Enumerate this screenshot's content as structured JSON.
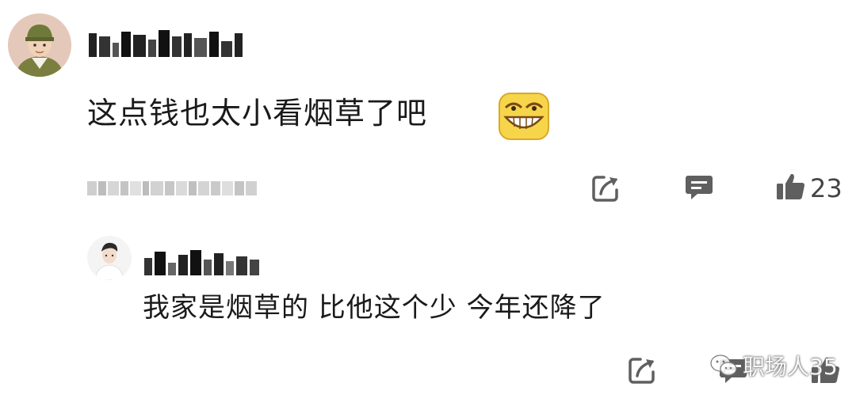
{
  "comment": {
    "text": "这点钱也太小看烟草了吧",
    "like_count": "23",
    "icons": {
      "share": "share-arrow-icon",
      "reply": "comment-bubble-icon",
      "like": "thumbs-up-icon"
    }
  },
  "reply": {
    "text": "我家是烟草的 比他这个少 今年还降了",
    "icons": {
      "share": "share-arrow-icon",
      "reply": "comment-bubble-icon",
      "like": "thumbs-up-icon"
    }
  },
  "watermark": {
    "text": "职场人35",
    "icon": "wechat-icon"
  },
  "colors": {
    "icon_gray": "#5f5f5f",
    "text": "#1a1a1a"
  }
}
